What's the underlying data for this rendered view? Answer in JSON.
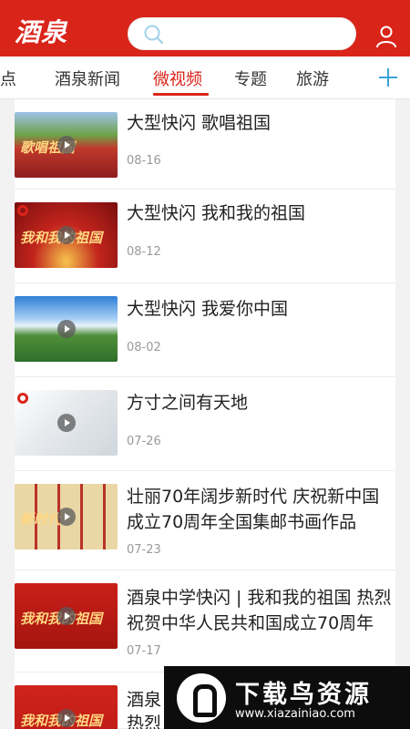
{
  "header": {
    "logo_text": "酒泉",
    "search_placeholder": "",
    "brand_color": "#d9241a"
  },
  "tabs": [
    {
      "label": "热点",
      "visible_text": "热点"
    },
    {
      "label": "酒泉新闻"
    },
    {
      "label": "微视频",
      "active": true
    },
    {
      "label": "专题"
    },
    {
      "label": "旅游"
    }
  ],
  "icons": {
    "search": "search-icon",
    "user": "user-icon",
    "add_channel": "plus-icon",
    "play": "play-icon"
  },
  "videos": [
    {
      "title": "大型快闪 歌唱祖国",
      "date": "08-16",
      "thumb_text": "歌唱祖国"
    },
    {
      "title": "大型快闪 我和我的祖国",
      "date": "08-12",
      "thumb_text": "我和我的祖国"
    },
    {
      "title": "大型快闪 我爱你中国",
      "date": "08-02",
      "thumb_text": ""
    },
    {
      "title": "方寸之间有天地",
      "date": "07-26",
      "thumb_text": ""
    },
    {
      "title": "壮丽70年阔步新时代 庆祝新中国成立70周年全国集邮书画作品",
      "date": "07-23",
      "thumb_text": "新时代"
    },
    {
      "title": "酒泉中学快闪 | 我和我的祖国 热烈祝贺中华人民共和国成立70周年",
      "date": "07-17",
      "thumb_text": "我和我的祖国"
    },
    {
      "title": "酒泉",
      "subtitle_partial": "热烈",
      "date": "",
      "thumb_text": "我和我的祖国"
    }
  ],
  "watermark": {
    "name": "下载鸟资源",
    "url": "www.xiazainiao.com"
  }
}
